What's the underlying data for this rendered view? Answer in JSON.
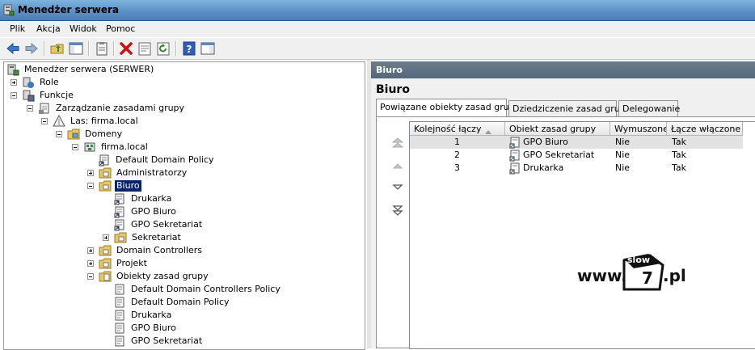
{
  "window": {
    "title": "Menedżer serwera"
  },
  "menu": [
    "Plik",
    "Akcja",
    "Widok",
    "Pomoc"
  ],
  "tree": {
    "root": "Menedżer serwera (SERWER)",
    "role": "Role",
    "funkcje": "Funkcje",
    "gpm": "Zarządzanie zasadami grupy",
    "las": "Las: firma.local",
    "domeny": "Domeny",
    "domain": "firma.local",
    "default_domain_policy": "Default Domain Policy",
    "administratorzy": "Administratorzy",
    "biuro": "Biuro",
    "drukarka": "Drukarka",
    "gpo_biuro": "GPO Biuro",
    "gpo_sekretariat": "GPO Sekretariat",
    "sekretariat": "Sekretariat",
    "domain_controllers": "Domain Controllers",
    "projekt": "Projekt",
    "obiekty": "Obiekty zasad grupy",
    "obj_ddcp": "Default Domain Controllers Policy",
    "obj_ddp": "Default Domain Policy",
    "obj_drukarka": "Drukarka",
    "obj_gpo_biuro": "GPO Biuro",
    "obj_gpo_sekretariat": "GPO Sekretariat"
  },
  "right": {
    "header": "Biuro",
    "title": "Biuro",
    "tabs": [
      "Powiązane obiekty zasad grupy",
      "Dziedziczenie zasad grupy",
      "Delegowanie"
    ],
    "columns": [
      "Kolejność łączy",
      "Obiekt zasad grupy",
      "Wymuszone",
      "Łącze włączone"
    ],
    "rows": [
      {
        "order": "1",
        "gpo": "GPO Biuro",
        "enforced": "Nie",
        "enabled": "Tak"
      },
      {
        "order": "2",
        "gpo": "GPO Sekretariat",
        "enforced": "Nie",
        "enabled": "Tak"
      },
      {
        "order": "3",
        "gpo": "Drukarka",
        "enforced": "Nie",
        "enabled": "Tak"
      }
    ]
  },
  "watermark": {
    "prefix": "www.",
    "top": "slow",
    "number": "7",
    "suffix": ".pl"
  }
}
